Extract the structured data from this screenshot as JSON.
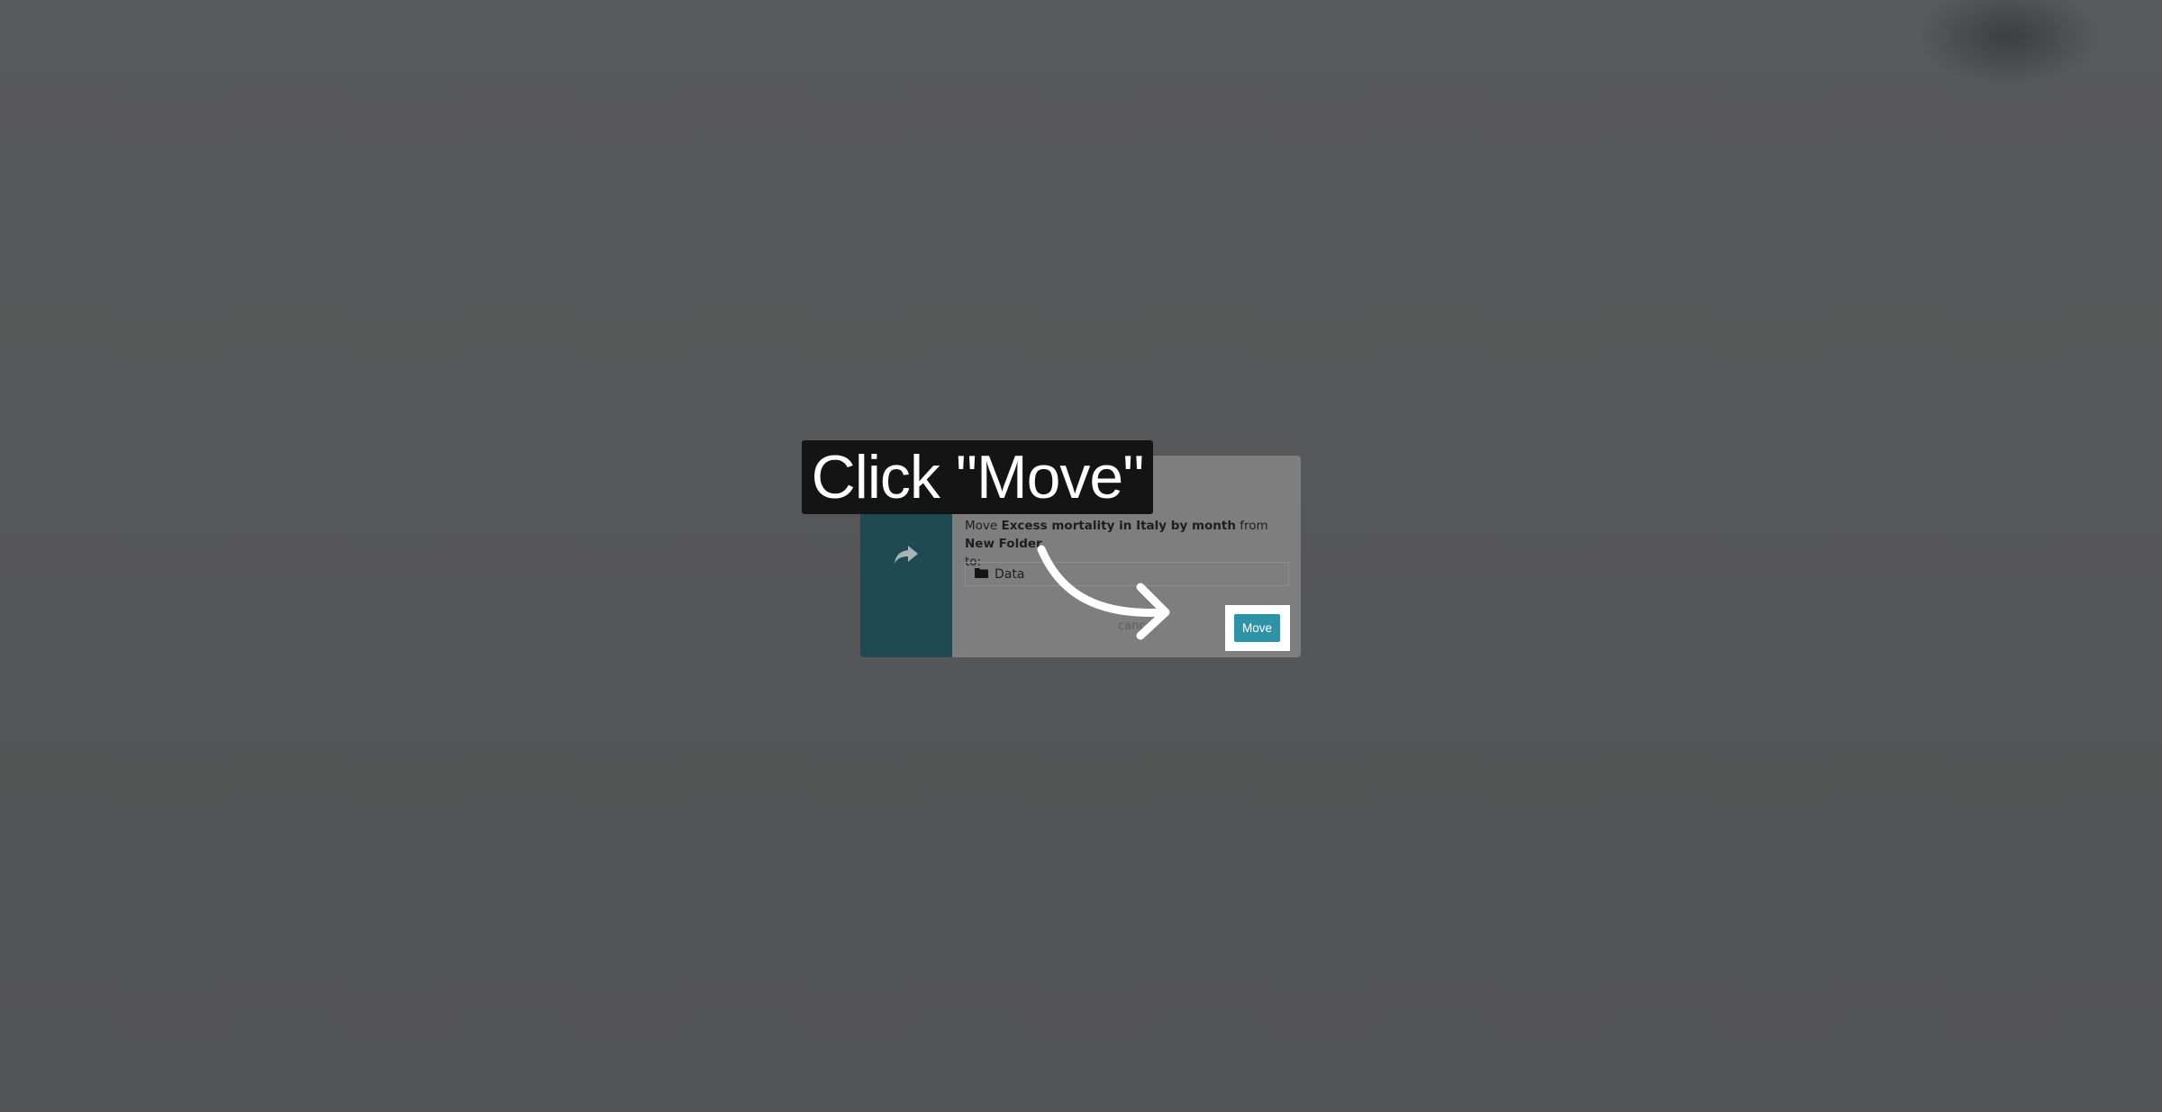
{
  "tutorial": {
    "instruction": "Click \"Move\""
  },
  "dialog": {
    "close_label": "×",
    "message_prefix": "Move",
    "item_name": "Excess mortality in Italy by month",
    "message_from": "from",
    "source_folder": "New Folder",
    "message_to": "to:",
    "destination_folder": "Data",
    "cancel_label": "cancel",
    "move_label": "Move",
    "side_icon": "share-arrow-icon",
    "folder_icon": "folder-icon"
  },
  "colors": {
    "overlay": "#545556",
    "dialog_side": "#1f4a54",
    "move_button": "#2f93a8",
    "highlight": "#ffffff",
    "tooltip": "#141414"
  }
}
